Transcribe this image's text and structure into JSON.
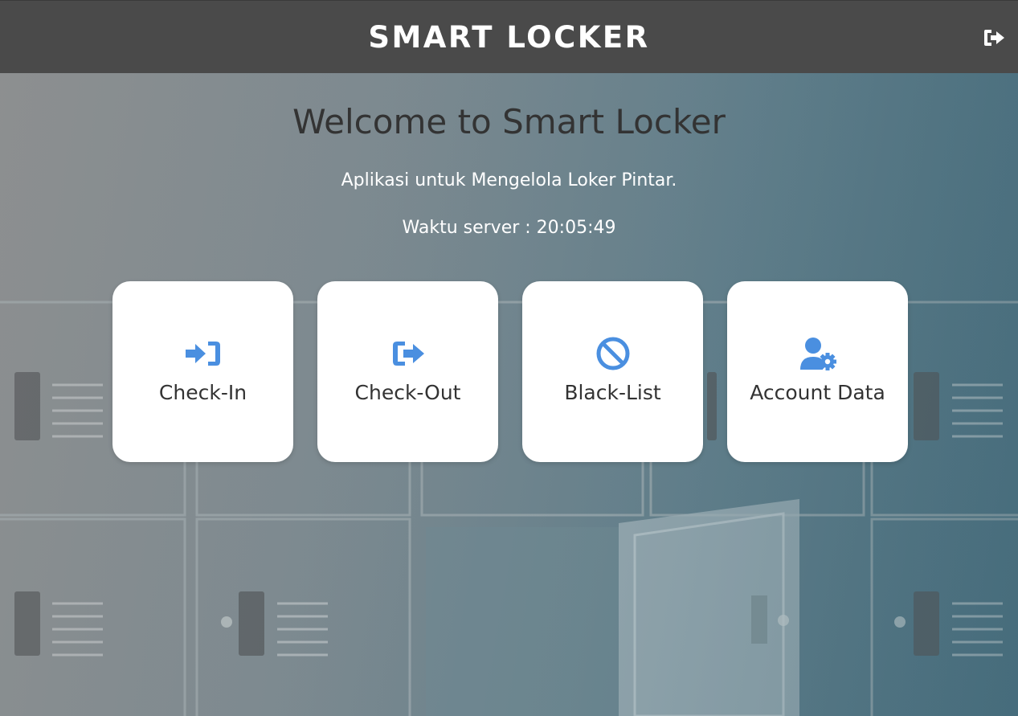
{
  "header": {
    "title": "SMART LOCKER",
    "logout_icon": "sign-out-icon"
  },
  "main": {
    "heading": "Welcome to Smart Locker",
    "subtitle": "Aplikasi untuk Mengelola Loker Pintar.",
    "server_time": "Waktu server : 20:05:49"
  },
  "menu": [
    {
      "label": "Check-In",
      "icon": "sign-in-icon"
    },
    {
      "label": "Check-Out",
      "icon": "sign-out-icon"
    },
    {
      "label": "Black-List",
      "icon": "ban-icon"
    },
    {
      "label": "Account Data",
      "icon": "user-cog-icon"
    }
  ],
  "colors": {
    "header_bg": "#4a4a4a",
    "accent_icon": "#4a8fe0",
    "card_bg": "#ffffff"
  }
}
